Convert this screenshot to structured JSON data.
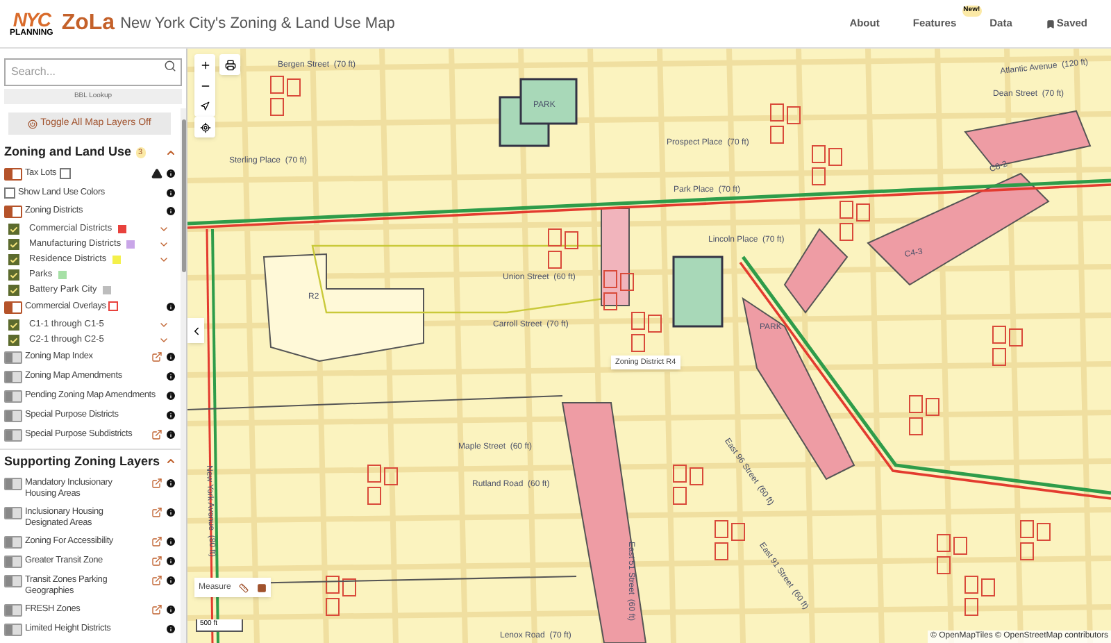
{
  "header": {
    "logo_top": "NYC",
    "logo_bottom": "PLANNING",
    "app_name": "ZoLa",
    "subtitle": "New York City's Zoning & Land Use Map",
    "nav": [
      {
        "label": "About",
        "kind": "link"
      },
      {
        "label": "Features",
        "kind": "link",
        "badge": "New!"
      },
      {
        "label": "Data",
        "kind": "link"
      },
      {
        "label": "Saved",
        "kind": "saved"
      }
    ]
  },
  "sidebar": {
    "search": {
      "placeholder": "Search..."
    },
    "bbl_lookup": "BBL Lookup",
    "toggle_all": "Toggle All Map Layers Off",
    "sections": [
      {
        "title": "Zoning and Land Use",
        "badge": "3",
        "expanded": true,
        "items": [
          {
            "kind": "layer",
            "label": "Tax Lots",
            "on": true,
            "inline_checkbox": false,
            "warning": true,
            "external": false
          },
          {
            "kind": "checkbox",
            "label": "Show Land Use Colors",
            "checked": false
          },
          {
            "kind": "layer",
            "label": "Zoning Districts",
            "on": true,
            "external": false,
            "children": [
              {
                "label": "Commercial Districts",
                "checked": true,
                "color": "#e8413c",
                "expandable": true
              },
              {
                "label": "Manufacturing Districts",
                "checked": true,
                "color": "#c9a6e8",
                "expandable": true
              },
              {
                "label": "Residence Districts",
                "checked": true,
                "color": "#f4f04a",
                "expandable": true
              },
              {
                "label": "Parks",
                "checked": true,
                "color": "#a6e0a6",
                "expandable": false
              },
              {
                "label": "Battery Park City",
                "checked": true,
                "color": "#bdbdbd",
                "expandable": false
              }
            ]
          },
          {
            "kind": "layer",
            "label": "Commercial Overlays",
            "on": true,
            "color": "#e8413c",
            "external": false,
            "children": [
              {
                "label": "C1-1 through C1-5",
                "checked": true,
                "expandable": true
              },
              {
                "label": "C2-1 through C2-5",
                "checked": true,
                "expandable": true
              }
            ]
          },
          {
            "kind": "layer",
            "label": "Zoning Map Index",
            "on": false,
            "external": true
          },
          {
            "kind": "layer",
            "label": "Zoning Map Amendments",
            "on": false,
            "external": false
          },
          {
            "kind": "layer",
            "label": "Pending Zoning Map Amendments",
            "on": false,
            "external": false
          },
          {
            "kind": "layer",
            "label": "Special Purpose Districts",
            "on": false,
            "external": false
          },
          {
            "kind": "layer",
            "label": "Special Purpose Subdistricts",
            "on": false,
            "external": true
          }
        ]
      },
      {
        "title": "Supporting Zoning Layers",
        "expanded": true,
        "items": [
          {
            "kind": "layer",
            "label": "Mandatory Inclusionary Housing Areas",
            "on": false,
            "external": true
          },
          {
            "kind": "layer",
            "label": "Inclusionary Housing Designated Areas",
            "on": false,
            "external": true
          },
          {
            "kind": "layer",
            "label": "Zoning For Accessibility",
            "on": false,
            "external": true
          },
          {
            "kind": "layer",
            "label": "Greater Transit Zone",
            "on": false,
            "external": true
          },
          {
            "kind": "layer",
            "label": "Transit Zones Parking Geographies",
            "on": false,
            "external": true
          },
          {
            "kind": "layer",
            "label": "FRESH Zones",
            "on": false,
            "external": true
          },
          {
            "kind": "layer",
            "label": "Limited Height Districts",
            "on": false,
            "external": false
          }
        ]
      }
    ]
  },
  "map": {
    "labels": [
      "Bergen Street  (70 ft)",
      "PARK",
      "Dean Street  (70 ft)",
      "Atlantic Avenue  (120 ft)",
      "Sterling Place  (70 ft)",
      "Prospect Place  (70 ft)",
      "Park Place  (70 ft)",
      "Lincoln Place  (70 ft)",
      "Union Street  (60 ft)",
      "R2",
      "Carroll Street  (70 ft)",
      "C4-3",
      "C8-2",
      "PARK",
      "Maple Street  (60 ft)",
      "Rutland Road  (60 ft)",
      "Lenox Road  (70 ft)",
      "East 51 Street  (60 ft)",
      "East 96 Street  (60 ft)",
      "East 91 Street  (60 ft)",
      "New York Avenue  (80 ft)"
    ],
    "tooltip": "Zoning District R4",
    "measure": "Measure",
    "scale": "500 ft",
    "attribution": "© OpenMapTiles © OpenStreetMap contributors"
  }
}
